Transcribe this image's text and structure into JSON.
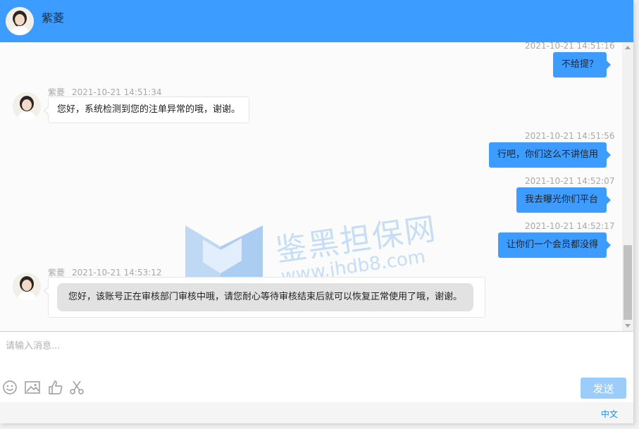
{
  "header": {
    "agent_name": "紫菱"
  },
  "messages": [
    {
      "side": "out",
      "time": "2021-10-21 14:51:16",
      "text": "不给提？"
    },
    {
      "side": "in",
      "name": "紫菱",
      "time": "2021-10-21 14:51:34",
      "text": "您好，系统检测到您的注单异常的哦，谢谢。"
    },
    {
      "side": "out",
      "time": "2021-10-21 14:51:56",
      "text": "行吧，你们这么不讲信用"
    },
    {
      "side": "out",
      "time": "2021-10-21 14:52:07",
      "text": "我去曝光你们平台"
    },
    {
      "side": "out",
      "time": "2021-10-21 14:52:17",
      "text": "让你们一个会员都没得"
    },
    {
      "side": "in",
      "name": "紫菱",
      "time": "2021-10-21 14:53:12",
      "text": "您好，该账号正在审核部门审核中哦，请您耐心等待审核结束后就可以恢复正常使用了哦，谢谢。"
    }
  ],
  "watermark": {
    "cn": "鉴黑担保网",
    "en": "www.jhdb8.com"
  },
  "composer": {
    "placeholder": "请输入消息...",
    "value": "",
    "send_label": "发送",
    "tools": [
      "emoji-icon",
      "image-icon",
      "thumbs-up-icon",
      "scissors-icon"
    ]
  },
  "footer": {
    "language": "中文"
  },
  "colors": {
    "header": "#3c9cff",
    "out_bubble": "#3c9cff",
    "send_button": "#9ccdfa",
    "link": "#2a8ae0"
  }
}
